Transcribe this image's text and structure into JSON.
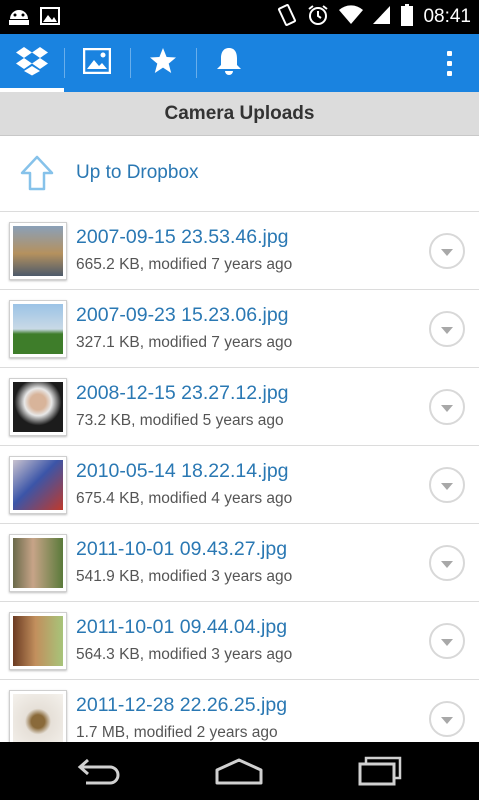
{
  "status_bar": {
    "time": "08:41",
    "left_icons": [
      "android-debug-icon",
      "image-notification-icon"
    ],
    "right_icons": [
      "vibrate-icon",
      "alarm-icon",
      "wifi-icon",
      "signal-icon",
      "battery-icon"
    ]
  },
  "action_bar": {
    "tabs": [
      {
        "icon": "dropbox-icon",
        "active": true
      },
      {
        "icon": "photos-icon",
        "active": false
      },
      {
        "icon": "star-icon",
        "active": false
      },
      {
        "icon": "bell-icon",
        "active": false
      }
    ],
    "overflow_icon": "overflow-menu-icon",
    "color": "#1a83e0"
  },
  "section_header": {
    "title": "Camera Uploads"
  },
  "up_row": {
    "label": "Up to Dropbox",
    "icon": "up-arrow-icon"
  },
  "files": [
    {
      "name": "2007-09-15 23.53.46.jpg",
      "meta": "665.2 KB, modified 7 years ago",
      "thumb_colors": [
        "#8aa0b8",
        "#b5915e",
        "#4d5a6a"
      ]
    },
    {
      "name": "2007-09-23 15.23.06.jpg",
      "meta": "327.1 KB, modified 7 years ago",
      "thumb_colors": [
        "#9bc3e6",
        "#c9d9e6",
        "#3e7d2a"
      ]
    },
    {
      "name": "2008-12-15 23.27.12.jpg",
      "meta": "73.2 KB, modified 5 years ago",
      "thumb_colors": [
        "#1c1c1c",
        "#d8b49a",
        "#e8e8e8"
      ]
    },
    {
      "name": "2010-05-14 18.22.14.jpg",
      "meta": "675.4 KB, modified 4 years ago",
      "thumb_colors": [
        "#c9c3cf",
        "#3b55a8",
        "#c0392b"
      ]
    },
    {
      "name": "2011-10-01 09.43.27.jpg",
      "meta": "541.9 KB, modified 3 years ago",
      "thumb_colors": [
        "#6a6a4a",
        "#c7a488",
        "#5a7a3a"
      ]
    },
    {
      "name": "2011-10-01 09.44.04.jpg",
      "meta": "564.3 KB, modified 3 years ago",
      "thumb_colors": [
        "#c28f5d",
        "#6b3b22",
        "#a7c47a"
      ]
    },
    {
      "name": "2011-12-28 22.26.25.jpg",
      "meta": "1.7 MB, modified 2 years ago",
      "thumb_colors": [
        "#e6e0d8",
        "#8a6a3a",
        "#f4f1ec"
      ]
    }
  ],
  "nav_bar": {
    "buttons": [
      "back-icon",
      "home-icon",
      "recents-icon"
    ]
  }
}
